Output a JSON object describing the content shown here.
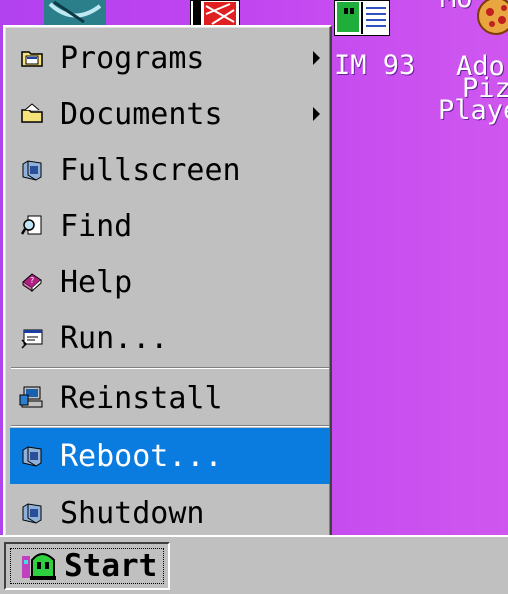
{
  "desktop": {
    "icons": [
      {
        "icon": "network-globe-icon",
        "label": ""
      },
      {
        "icon": "red-app-icon",
        "label": ""
      },
      {
        "icon": "notepad-book-icon",
        "label": "IM 93"
      },
      {
        "icon": "pizza-icon",
        "label_lines": [
          "Ado",
          "Piz",
          "Playe"
        ],
        "top_label": "Mo"
      }
    ]
  },
  "start_menu": {
    "items": [
      {
        "label": "Programs",
        "icon": "programs-folder-icon",
        "submenu": true
      },
      {
        "label": "Documents",
        "icon": "documents-folder-icon",
        "submenu": true
      },
      {
        "label": "Fullscreen",
        "icon": "monitor-cube-icon",
        "submenu": false
      },
      {
        "label": "Find",
        "icon": "find-magnifier-icon",
        "submenu": false
      },
      {
        "label": "Help",
        "icon": "help-book-icon",
        "submenu": false
      },
      {
        "label": "Run...",
        "icon": "run-window-icon",
        "submenu": false
      },
      {
        "label": "Reinstall",
        "icon": "reinstall-computer-icon",
        "submenu": false
      },
      {
        "label": "Reboot...",
        "icon": "reboot-cube-icon",
        "submenu": false,
        "selected": true
      },
      {
        "label": "Shutdown",
        "icon": "shutdown-cube-icon",
        "submenu": false
      }
    ]
  },
  "taskbar": {
    "start_label": "Start",
    "start_icon": "green-alien-logo-icon"
  },
  "colors": {
    "desktop_left": "#b241f0",
    "desktop_right": "#cf57ef",
    "menu_face": "#c0c0c0",
    "highlight": "#0a7ce0"
  }
}
